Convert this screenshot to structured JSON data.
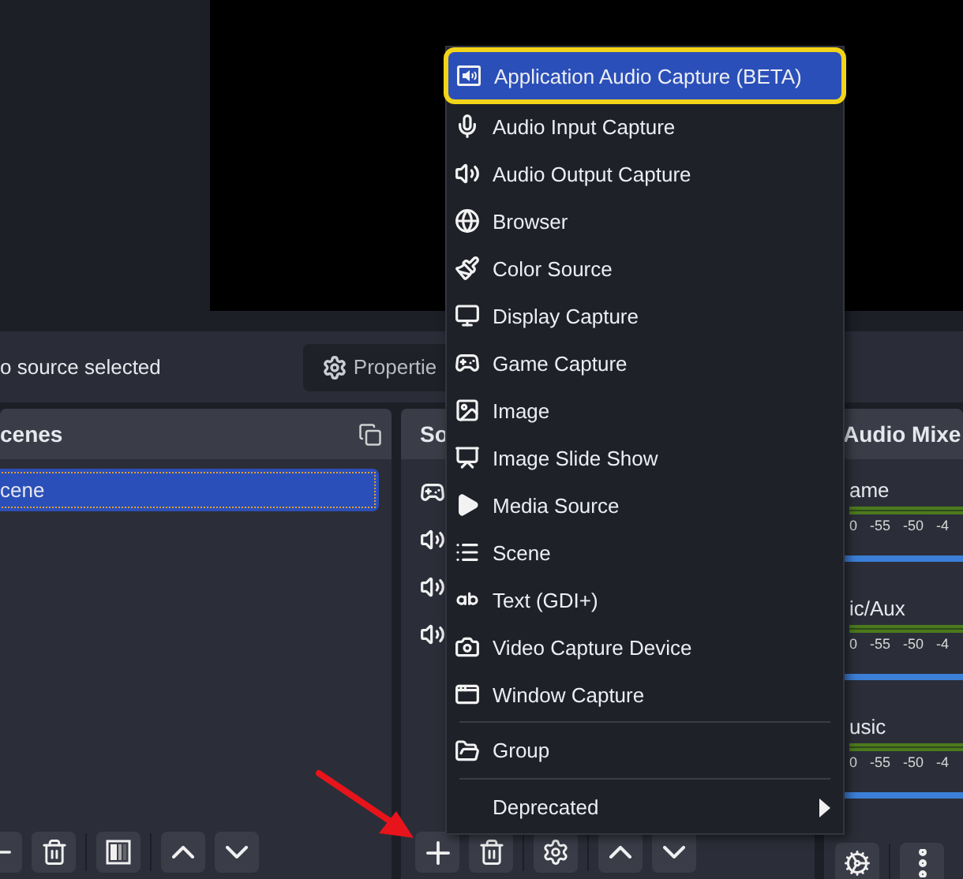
{
  "context_bar": {
    "status": "o source selected",
    "properties_button": "Propertie"
  },
  "scenes": {
    "title": "cenes",
    "items": [
      {
        "label": "cene",
        "selected": true
      }
    ]
  },
  "sources": {
    "title": "So",
    "items": [
      {
        "kind": "game"
      },
      {
        "kind": "audio"
      },
      {
        "kind": "audio"
      },
      {
        "kind": "audio"
      }
    ]
  },
  "audio_mixer": {
    "title": "Audio Mixe",
    "channels": [
      {
        "name": "ame",
        "scale": [
          "0",
          "-55",
          "-50",
          "-4"
        ]
      },
      {
        "name": "ic/Aux",
        "scale": [
          "0",
          "-55",
          "-50",
          "-4"
        ]
      },
      {
        "name": "usic",
        "scale": [
          "0",
          "-55",
          "-50",
          "-4"
        ]
      }
    ]
  },
  "add_source_menu": {
    "sections": [
      [
        {
          "kind": "appaudio",
          "label": "Application Audio Capture (BETA)",
          "selected": true,
          "highlighted": true
        },
        {
          "kind": "mic",
          "label": "Audio Input Capture",
          "selected": false,
          "highlighted": false
        },
        {
          "kind": "speaker",
          "label": "Audio Output Capture",
          "selected": false,
          "highlighted": false
        },
        {
          "kind": "browser",
          "label": "Browser",
          "selected": false,
          "highlighted": false
        },
        {
          "kind": "color",
          "label": "Color Source",
          "selected": false,
          "highlighted": false
        },
        {
          "kind": "display",
          "label": "Display Capture",
          "selected": false,
          "highlighted": false
        },
        {
          "kind": "game",
          "label": "Game Capture",
          "selected": false,
          "highlighted": false
        },
        {
          "kind": "image",
          "label": "Image",
          "selected": false,
          "highlighted": false
        },
        {
          "kind": "slideshow",
          "label": "Image Slide Show",
          "selected": false,
          "highlighted": false
        },
        {
          "kind": "media",
          "label": "Media Source",
          "selected": false,
          "highlighted": false
        },
        {
          "kind": "scene",
          "label": "Scene",
          "selected": false,
          "highlighted": false
        },
        {
          "kind": "text",
          "label": "Text (GDI+)",
          "selected": false,
          "highlighted": false
        },
        {
          "kind": "camera",
          "label": "Video Capture Device",
          "selected": false,
          "highlighted": false
        },
        {
          "kind": "window",
          "label": "Window Capture",
          "selected": false,
          "highlighted": false
        }
      ],
      [
        {
          "kind": "group",
          "label": "Group",
          "selected": false,
          "highlighted": false
        }
      ],
      [
        {
          "kind": "submenu",
          "label": "Deprecated",
          "selected": false,
          "highlighted": false
        }
      ]
    ]
  },
  "annotation_arrow": true
}
